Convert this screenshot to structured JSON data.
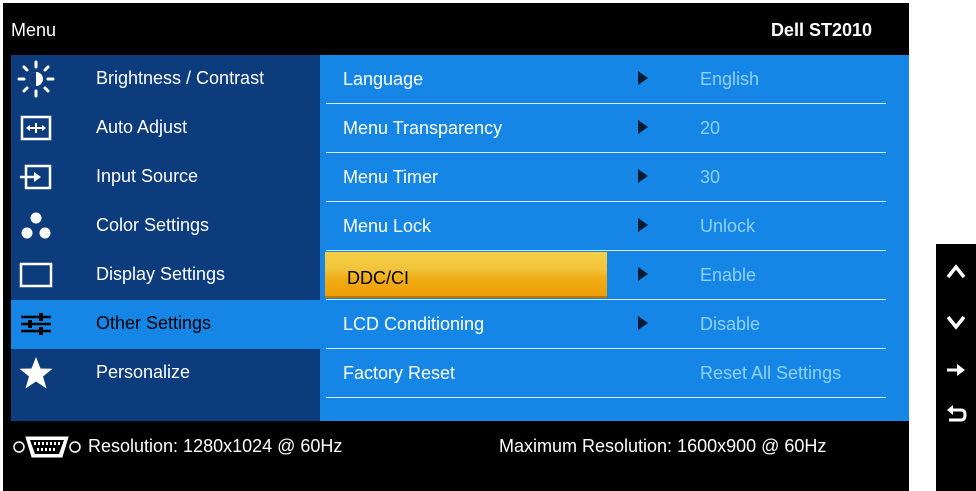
{
  "header": {
    "title": "Menu",
    "model": "Dell ST2010"
  },
  "left_menu": {
    "items": [
      {
        "label": "Brightness / Contrast",
        "icon": "brightness-icon"
      },
      {
        "label": "Auto Adjust",
        "icon": "auto-adjust-icon"
      },
      {
        "label": "Input Source",
        "icon": "input-source-icon"
      },
      {
        "label": "Color Settings",
        "icon": "color-settings-icon"
      },
      {
        "label": "Display Settings",
        "icon": "display-settings-icon"
      },
      {
        "label": "Other Settings",
        "icon": "other-settings-icon",
        "selected": true
      },
      {
        "label": "Personalize",
        "icon": "star-icon"
      }
    ]
  },
  "settings": {
    "rows": [
      {
        "label": "Language",
        "value": "English",
        "arrow": true
      },
      {
        "label": "Menu Transparency",
        "value": "20",
        "arrow": true
      },
      {
        "label": "Menu Timer",
        "value": "30",
        "arrow": true
      },
      {
        "label": "Menu Lock",
        "value": "Unlock",
        "arrow": true
      },
      {
        "label": "DDC/CI",
        "value": "Enable",
        "arrow": true,
        "highlighted": true
      },
      {
        "label": "LCD Conditioning",
        "value": "Disable",
        "arrow": true
      },
      {
        "label": "Factory Reset",
        "value": "Reset All Settings",
        "arrow": false
      }
    ]
  },
  "status": {
    "connector_icon": "vga-connector-icon",
    "resolution": "Resolution: 1280x1024 @ 60Hz",
    "max_resolution": "Maximum  Resolution: 1600x900 @ 60Hz"
  },
  "buttons": [
    {
      "icon": "up-arrow-icon",
      "glyph": "up"
    },
    {
      "icon": "down-arrow-icon",
      "glyph": "down"
    },
    {
      "icon": "enter-arrow-icon",
      "glyph": "right"
    },
    {
      "icon": "back-icon",
      "glyph": "back"
    }
  ],
  "colors": {
    "left_panel": "#0c3c7c",
    "right_panel": "#1586e6",
    "highlight": "#f0ad14",
    "value_text": "#8fd0ff"
  }
}
